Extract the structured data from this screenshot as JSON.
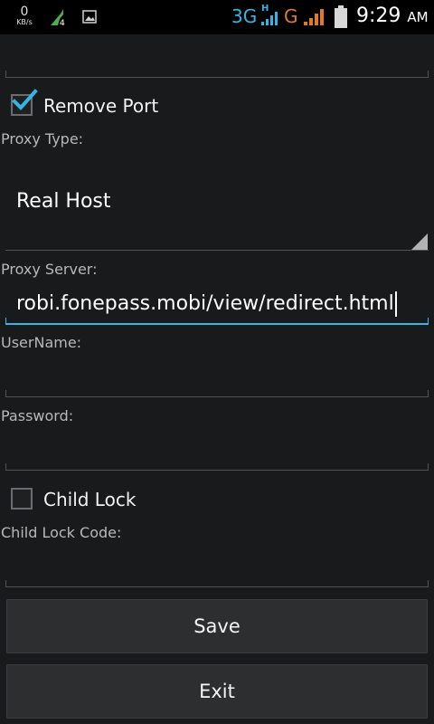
{
  "status_bar": {
    "speed_value": "0",
    "speed_unit": "KB/s",
    "signal_badge": "4",
    "network_3g": "3G",
    "network_h": "H",
    "network_g": "G",
    "time": "9:29",
    "ampm": "AM",
    "icons": [
      "network-speed-icon",
      "signal-4-icon",
      "image-icon",
      "signal-bars-icon",
      "battery-icon"
    ]
  },
  "form": {
    "remove_port": {
      "label": "Remove Port",
      "checked": true
    },
    "proxy_type": {
      "label": "Proxy Type:",
      "value": "Real Host"
    },
    "proxy_server": {
      "label": "Proxy Server:",
      "value": "robi.fonepass.mobi/view/redirect.html"
    },
    "username": {
      "label": "UserName:",
      "value": ""
    },
    "password": {
      "label": "Password:",
      "value": ""
    },
    "child_lock": {
      "label": "Child Lock",
      "checked": false
    },
    "child_lock_code": {
      "label": "Child Lock Code:",
      "value": ""
    }
  },
  "buttons": {
    "save": "Save",
    "exit": "Exit"
  },
  "colors": {
    "accent": "#33b5e5",
    "network_g": "#e07a2a",
    "background": "#191a1c"
  }
}
